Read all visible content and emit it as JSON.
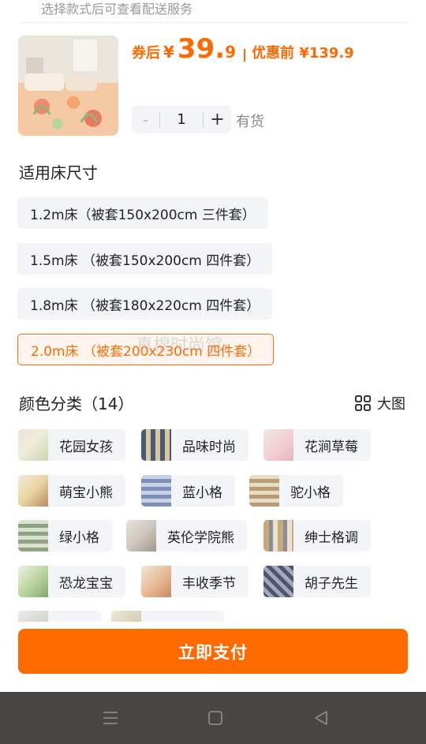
{
  "hint": "选择款式后可查看配送服务",
  "product": {
    "price_label": "券后",
    "currency": "¥",
    "price_int": "39.",
    "price_dec": "9",
    "original_price": "优惠前 ¥139.9",
    "quantity": "1",
    "minus": "-",
    "plus": "+",
    "stock": "有货"
  },
  "size": {
    "title": "适用床尺寸",
    "options": [
      {
        "label": "1.2m床（被套150x200cm 三件套）"
      },
      {
        "label": "1.5m床 （被套150x200cm 四件套）"
      },
      {
        "label": "1.8m床 （被套180x220cm 四件套）"
      },
      {
        "label": "2.0m床 （被套200x230cm 四件套）"
      }
    ],
    "selected_index": 3,
    "watermark": "真棉时尚馆"
  },
  "colors": {
    "title": "颜色分类（14）",
    "bigview": "大图",
    "items": [
      {
        "label": "花园女孩"
      },
      {
        "label": "品味时尚"
      },
      {
        "label": "花涧草莓"
      },
      {
        "label": "萌宝小熊"
      },
      {
        "label": "蓝小格"
      },
      {
        "label": "驼小格"
      },
      {
        "label": "绿小格"
      },
      {
        "label": "英伦学院熊"
      },
      {
        "label": "绅士格调"
      },
      {
        "label": "恐龙宝宝"
      },
      {
        "label": "丰收季节"
      },
      {
        "label": "胡子先生"
      }
    ]
  },
  "pay_button": "立即支付",
  "theme": {
    "accent": "#ff6a00",
    "chip_bg": "#f2f4f7",
    "navbar_bg": "#494746"
  },
  "navbar": {
    "icons": [
      "menu-icon",
      "home-square-icon",
      "back-triangle-icon"
    ]
  }
}
